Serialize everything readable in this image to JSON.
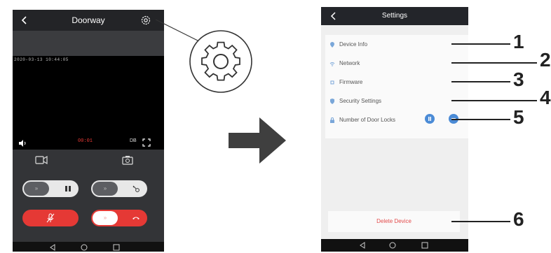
{
  "left_phone": {
    "title": "Doorway",
    "timestamp": "2020-03-13 10:44:05",
    "timer": "00:01",
    "db_label": "DB",
    "icons": {
      "back": "back-chevron-icon",
      "settings": "gear-icon",
      "speaker": "speaker-icon",
      "fullscreen": "fullscreen-icon",
      "record": "video-record-icon",
      "snapshot": "camera-snapshot-icon",
      "pause": "pause-icon",
      "key": "key-icon",
      "mute_mic": "mic-off-icon",
      "hangup": "hang-up-icon"
    },
    "slider_chevrons": "»",
    "colors": {
      "accent_red": "#e53935",
      "panel": "#2f3033",
      "header": "#232427"
    }
  },
  "right_phone": {
    "title": "Settings",
    "items": [
      {
        "label": "Device Info",
        "icon": "location-pin-icon"
      },
      {
        "label": "Network",
        "icon": "wifi-icon"
      },
      {
        "label": "Firmware",
        "icon": "chip-icon"
      },
      {
        "label": "Security Settings",
        "icon": "shield-icon"
      },
      {
        "label": "Number of Door Locks",
        "icon": "lock-icon"
      }
    ],
    "delete_label": "Delete Device",
    "colors": {
      "accent_blue": "#4b8bd6",
      "delete_red": "#e34b4b",
      "bg": "#efefef"
    }
  },
  "callouts": [
    "1",
    "2",
    "3",
    "4",
    "5",
    "6"
  ],
  "nav_icons": [
    "back-triangle-icon",
    "home-circle-icon",
    "recents-square-icon"
  ]
}
